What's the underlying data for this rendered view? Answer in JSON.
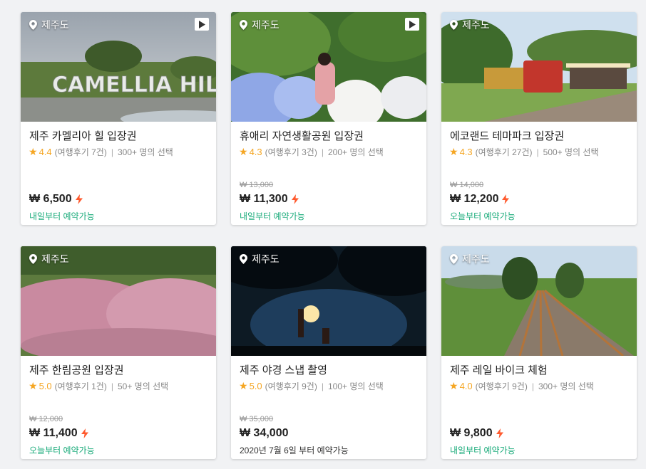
{
  "cards": [
    {
      "location": "제주도",
      "title": "제주 카멜리아 힐 입장권",
      "score": "4.4",
      "reviews": "(여행후기 7건)",
      "chosen": "300+ 명의 선택",
      "orig_price": "",
      "price": "₩ 6,500",
      "availability": "내일부터 예약가능",
      "has_video": true,
      "sign_text": "CAMELLIA HILL"
    },
    {
      "location": "제주도",
      "title": "휴애리 자연생활공원 입장권",
      "score": "4.3",
      "reviews": "(여행후기 3건)",
      "chosen": "200+ 명의 선택",
      "orig_price": "₩ 13,000",
      "price": "₩ 11,300",
      "availability": "내일부터 예약가능",
      "has_video": true
    },
    {
      "location": "제주도",
      "title": "에코랜드 테마파크 입장권",
      "score": "4.3",
      "reviews": "(여행후기 27건)",
      "chosen": "500+ 명의 선택",
      "orig_price": "₩ 14,000",
      "price": "₩ 12,200",
      "availability": "오늘부터 예약가능",
      "has_video": false
    },
    {
      "location": "제주도",
      "title": "제주 한림공원 입장권",
      "score": "5.0",
      "reviews": "(여행후기 1건)",
      "chosen": "50+ 명의 선택",
      "orig_price": "₩ 12,000",
      "price": "₩ 11,400",
      "availability": "오늘부터 예약가능",
      "has_video": false
    },
    {
      "location": "제주도",
      "title": "제주 야경 스냅 촬영",
      "score": "5.0",
      "reviews": "(여행후기 9건)",
      "chosen": "100+ 명의 선택",
      "orig_price": "₩ 35,000",
      "price": "₩ 34,000",
      "availability": "2020년 7월 6일 부터 예약가능",
      "has_video": false
    },
    {
      "location": "제주도",
      "title": "제주 레일 바이크 체험",
      "score": "4.0",
      "reviews": "(여행후기 9건)",
      "chosen": "300+ 명의 선택",
      "orig_price": "",
      "price": "₩ 9,800",
      "availability": "내일부터 예약가능",
      "has_video": false
    }
  ],
  "colors": {
    "accent_green": "#1aab7a",
    "star": "#f5a623",
    "bolt": "#ff5a2e"
  }
}
